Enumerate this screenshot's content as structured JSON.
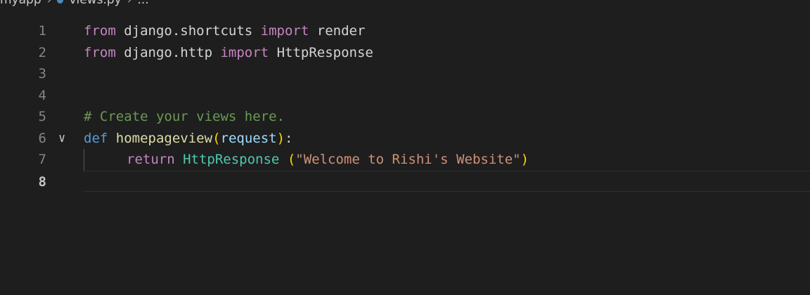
{
  "breadcrumb": {
    "folder": "myapp",
    "file": "views.py",
    "symbol": "..."
  },
  "editor": {
    "current_line": 8,
    "lines": [
      {
        "number": "1",
        "tokens": [
          {
            "text": "from",
            "kind": "kw-ctrl"
          },
          {
            "text": " django.shortcuts ",
            "kind": "plain"
          },
          {
            "text": "import",
            "kind": "kw-ctrl"
          },
          {
            "text": " render",
            "kind": "plain"
          }
        ]
      },
      {
        "number": "2",
        "tokens": [
          {
            "text": "from",
            "kind": "kw-ctrl"
          },
          {
            "text": " django.http ",
            "kind": "plain"
          },
          {
            "text": "import",
            "kind": "kw-ctrl"
          },
          {
            "text": " HttpResponse",
            "kind": "plain"
          }
        ]
      },
      {
        "number": "3",
        "tokens": []
      },
      {
        "number": "4",
        "tokens": []
      },
      {
        "number": "5",
        "tokens": [
          {
            "text": "# Create your views here.",
            "kind": "cmt"
          }
        ]
      },
      {
        "number": "6",
        "tokens": [
          {
            "text": "def",
            "kind": "kw"
          },
          {
            "text": " ",
            "kind": "plain"
          },
          {
            "text": "homepageview",
            "kind": "fn"
          },
          {
            "text": "(",
            "kind": "paren"
          },
          {
            "text": "request",
            "kind": "param"
          },
          {
            "text": ")",
            "kind": "paren"
          },
          {
            "text": ":",
            "kind": "plain"
          }
        ]
      },
      {
        "number": "7",
        "tokens": [
          {
            "text": "return",
            "kind": "kw-ctrl"
          },
          {
            "text": " ",
            "kind": "plain"
          },
          {
            "text": "HttpResponse",
            "kind": "cls"
          },
          {
            "text": " ",
            "kind": "plain"
          },
          {
            "text": "(",
            "kind": "paren"
          },
          {
            "text": "\"Welcome to Rishi's Website\"",
            "kind": "str"
          },
          {
            "text": ")",
            "kind": "paren"
          }
        ]
      },
      {
        "number": "8",
        "tokens": []
      }
    ]
  },
  "icons": {
    "fold": "chevron-down-icon",
    "file": "python-file-icon"
  },
  "colors": {
    "background": "#1e1e1e",
    "keyword_control": "#c586c0",
    "keyword": "#569cd6",
    "class": "#4ec9b0",
    "function": "#dcdcaa",
    "parameter": "#9cdcfe",
    "string": "#ce9178",
    "comment": "#6a9955",
    "bracket": "#ffd700"
  }
}
